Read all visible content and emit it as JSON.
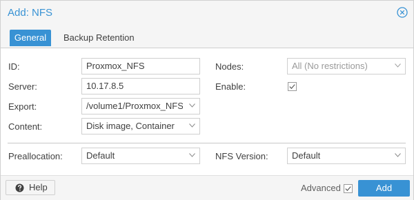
{
  "dialog": {
    "title": "Add: NFS",
    "close_icon": "close-circle-icon"
  },
  "tabs": [
    {
      "label": "General",
      "active": true
    },
    {
      "label": "Backup Retention",
      "active": false
    }
  ],
  "form": {
    "id": {
      "label": "ID:",
      "value": "Proxmox_NFS"
    },
    "server": {
      "label": "Server:",
      "value": "10.17.8.5"
    },
    "export": {
      "label": "Export:",
      "value": "/volume1/Proxmox_NFS"
    },
    "content": {
      "label": "Content:",
      "value": "Disk image, Container"
    },
    "nodes": {
      "label": "Nodes:",
      "value": "All (No restrictions)"
    },
    "enable": {
      "label": "Enable:",
      "checked": true
    },
    "preallocation": {
      "label": "Preallocation:",
      "value": "Default"
    },
    "nfs_version": {
      "label": "NFS Version:",
      "value": "Default"
    }
  },
  "footer": {
    "help_label": "Help",
    "help_icon": "question-circle-icon",
    "advanced_label": "Advanced",
    "advanced_checked": true,
    "add_label": "Add"
  },
  "colors": {
    "accent": "#3892d4",
    "panel_bg": "#f5f5f5"
  }
}
